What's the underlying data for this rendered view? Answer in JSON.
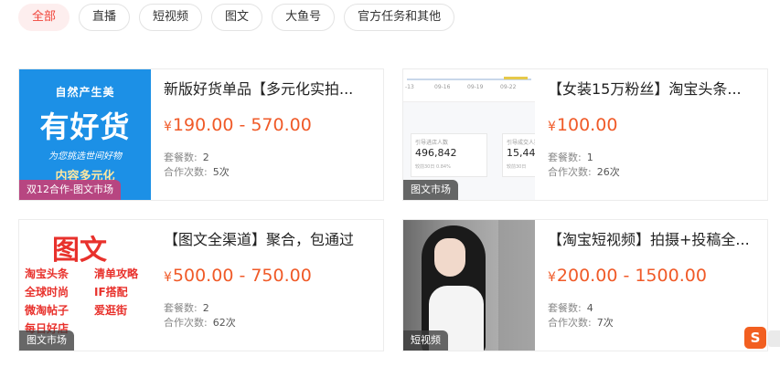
{
  "tabs": [
    {
      "label": "全部",
      "active": true
    },
    {
      "label": "直播",
      "active": false
    },
    {
      "label": "短视频",
      "active": false
    },
    {
      "label": "图文",
      "active": false
    },
    {
      "label": "大鱼号",
      "active": false
    },
    {
      "label": "官方任务和其他",
      "active": false
    }
  ],
  "labels": {
    "package_count": "套餐数:",
    "collab_count": "合作次数:",
    "currency": "¥"
  },
  "cards": [
    {
      "title": "新版好货单品【多元化实拍...",
      "price": "190.00 - 570.00",
      "packages": "2",
      "collabs": "5次",
      "badge": "双12合作-图文市场",
      "thumb": {
        "line1": "自然产生美",
        "line2": "有好货",
        "line3": "为您挑选世间好物",
        "line4": "内容多元化"
      }
    },
    {
      "title": "【女装15万粉丝】淘宝头条...",
      "price": "100.00",
      "packages": "1",
      "collabs": "26次",
      "badge": "图文市场",
      "thumb": {
        "ticks": [
          "-13",
          "09-16",
          "09-19",
          "09-22"
        ],
        "panel1_label": "引导进店人数",
        "panel1_value": "496,842",
        "panel1_sub": "较前30日  0.84%",
        "panel2_label": "引导成交人数",
        "panel2_value": "15,449",
        "panel2_sub": "较前30日"
      }
    },
    {
      "title": "【图文全渠道】聚合，包通过",
      "price": "500.00 - 750.00",
      "packages": "2",
      "collabs": "62次",
      "badge": "图文市场",
      "thumb": {
        "heading": "图文",
        "items": [
          "淘宝头条",
          "清单攻略",
          "全球时尚",
          "IF搭配",
          "微淘帖子",
          "爱逛街",
          "每日好店"
        ]
      }
    },
    {
      "title": "【淘宝短视频】拍摄+投稿全...",
      "price": "200.00 - 1500.00",
      "packages": "4",
      "collabs": "7次",
      "badge": "短视频",
      "thumb": {}
    }
  ],
  "floating_icon": {
    "label": "S",
    "icon": "sogou-icon"
  },
  "colors": {
    "accent": "#f05a28",
    "active_tab_bg": "#fdeeee",
    "active_tab_text": "#f0443a"
  }
}
